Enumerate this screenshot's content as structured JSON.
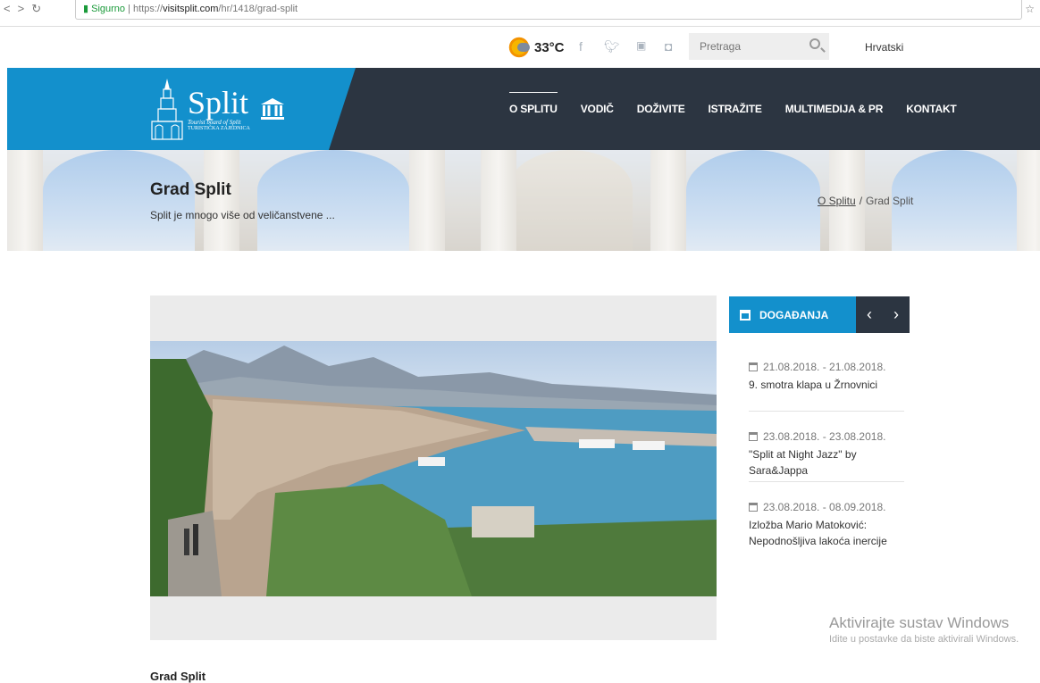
{
  "browser": {
    "secure_label": "Sigurno",
    "url_prefix": "https://",
    "url_host": "visitsplit.com",
    "url_path": "/hr/1418/grad-split"
  },
  "topbar": {
    "temperature": "33°C",
    "search_placeholder": "Pretraga",
    "language": "Hrvatski"
  },
  "logo": {
    "name": "Split",
    "tagline_1": "Tourist board of Split",
    "tagline_2": "TURISTIČKA ZAJEDNICA"
  },
  "menu": [
    {
      "label": "O SPLITU",
      "active": true
    },
    {
      "label": "VODIČ"
    },
    {
      "label": "DOŽIVITE"
    },
    {
      "label": "ISTRAŽITE"
    },
    {
      "label": "MULTIMEDIJA & PR"
    },
    {
      "label": "KONTAKT"
    }
  ],
  "hero": {
    "title": "Grad Split",
    "subtitle": "Split je mnogo više od veličanstvene ...",
    "breadcrumb": [
      "O Splitu",
      "Grad Split"
    ],
    "breadcrumb_sep": "/"
  },
  "events": {
    "title": "DOGAĐANJA",
    "items": [
      {
        "date": "21.08.2018. - 21.08.2018.",
        "title": "9. smotra klapa u Žrnovnici"
      },
      {
        "date": "23.08.2018. - 23.08.2018.",
        "title": "\"Split at Night Jazz\" by Sara&Jappa"
      },
      {
        "date": "23.08.2018. - 08.09.2018.",
        "title": "Izložba Mario Matoković: Nepodnošljiva lakoća inercije"
      }
    ]
  },
  "content": {
    "title": "Grad Split"
  },
  "watermark": {
    "line1": "Aktivirajte sustav Windows",
    "line2": "Idite u postavke da biste aktivirali Windows."
  },
  "colors": {
    "brand_blue": "#1390cc",
    "header_dark": "#2c3541"
  }
}
